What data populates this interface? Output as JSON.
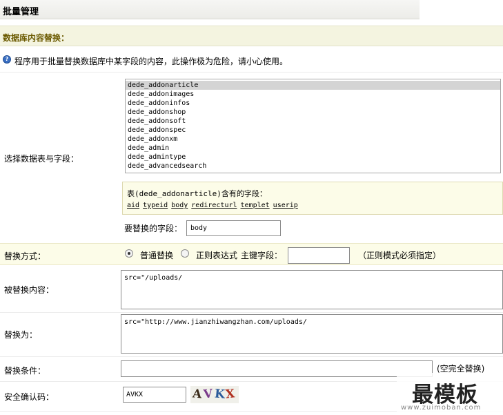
{
  "header": {
    "title": "批量管理"
  },
  "section": {
    "title": "数据库内容替换："
  },
  "info": {
    "text": "程序用于批量替换数据库中某字段的内容，此操作极为危险，请小心使用。"
  },
  "labels": {
    "table_field": "选择数据表与字段：",
    "mode": "替换方式：",
    "search": "被替换内容：",
    "replace": "替换为：",
    "condition": "替换条件：",
    "captcha": "安全确认码："
  },
  "tables": {
    "selected": "dede_addonarticle",
    "items": [
      "dede_addonarticle",
      "dede_addonimages",
      "dede_addoninfos",
      "dede_addonshop",
      "dede_addonsoft",
      "dede_addonspec",
      "dede_addonxm",
      "dede_admin",
      "dede_admintype",
      "dede_advancedsearch"
    ]
  },
  "fields": {
    "title": "表(dede_addonarticle)含有的字段：",
    "items": [
      "aid",
      "typeid",
      "body",
      "redirecturl",
      "templet",
      "userip"
    ]
  },
  "field_to_replace": {
    "label": "要替换的字段：",
    "value": "body"
  },
  "mode": {
    "options": [
      "普通替换",
      "正则表达式"
    ],
    "selected": "普通替换",
    "key_field_label": "主键字段：",
    "key_field_value": "",
    "note": "（正则模式必须指定）"
  },
  "search_text": "src=\"/uploads/",
  "replace_text": "src=\"http://www.jianzhiwangzhan.com/uploads/",
  "condition": {
    "value": "",
    "note": "(空完全替换)"
  },
  "captcha": {
    "value": "AVKX",
    "image_chars": [
      "A",
      "V",
      "K",
      "X"
    ]
  },
  "watermark": {
    "text": "最模板",
    "url": "www.zuimoban.com"
  },
  "colors": {
    "section_title": "#6b5a00",
    "highlight_bg": "#fcfce8"
  }
}
